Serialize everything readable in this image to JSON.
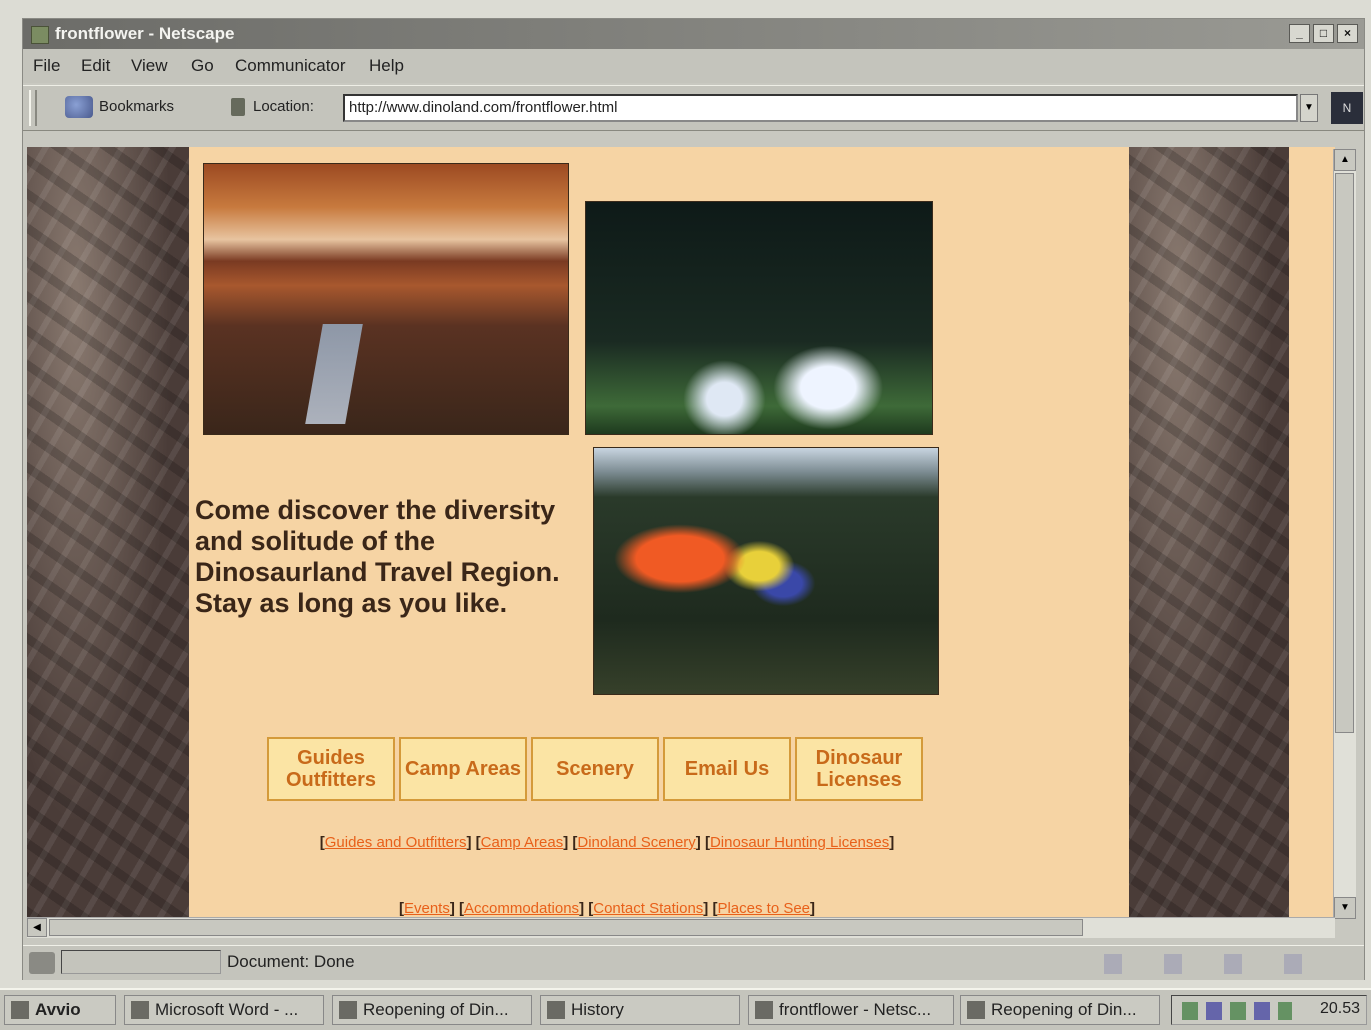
{
  "window": {
    "title": "frontflower - Netscape"
  },
  "menu": [
    "File",
    "Edit",
    "View",
    "Go",
    "Communicator",
    "Help"
  ],
  "toolbar": {
    "bookmarks_label": "Bookmarks",
    "location_label": "Location:",
    "url": "http://www.dinoland.com/frontflower.html"
  },
  "page": {
    "tagline": "Come discover the diversity and solitude of the Dinosaurland Travel Region. Stay as long as you like.",
    "nav_buttons": [
      "Guides Outfitters",
      "Camp Areas",
      "Scenery",
      "Email Us",
      "Dinosaur Licenses"
    ],
    "text_links_row1": [
      "Guides and Outfitters",
      "Camp Areas",
      "Dinoland Scenery",
      "Dinosaur Hunting Licenses"
    ],
    "text_links_row2": [
      "Events",
      "Accommodations",
      "Contact Stations",
      "Places to See"
    ]
  },
  "status": {
    "text": "Document: Done"
  },
  "taskbar": {
    "start": "Avvio",
    "tasks": [
      "Microsoft Word - ...",
      "Reopening of Din...",
      "History",
      "frontflower - Netsc...",
      "Reopening of Din..."
    ],
    "clock": "20.53"
  }
}
